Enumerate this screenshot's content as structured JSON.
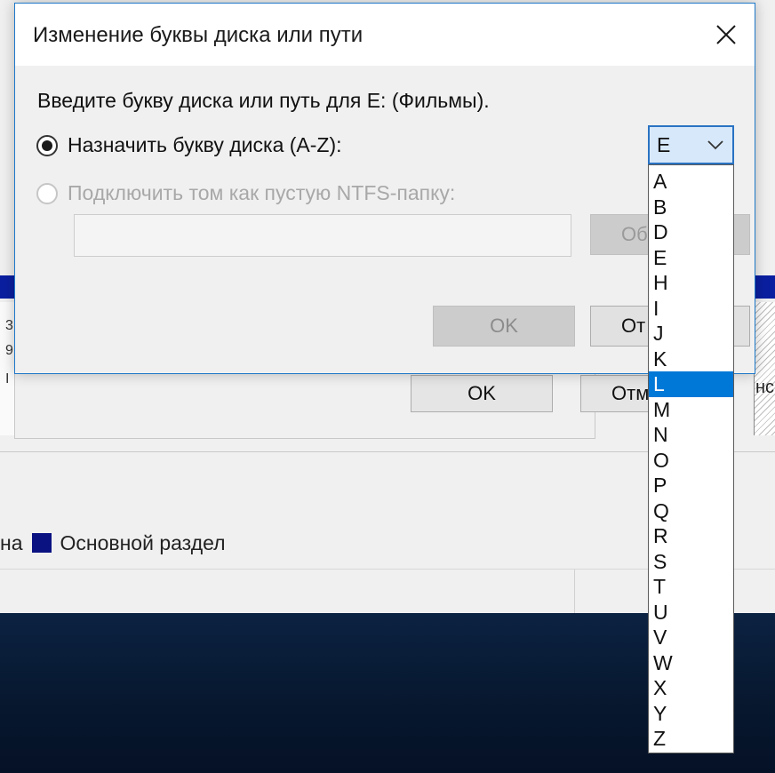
{
  "dialog": {
    "title": "Изменение буквы диска или пути",
    "prompt": "Введите букву диска или путь для E: (Фильмы).",
    "radio_assign_label": "Назначить букву диска (A-Z):",
    "radio_mount_label": "Подключить том как пустую NTFS-папку:",
    "path_value": "",
    "browse_label": "Об",
    "ok_label": "OK",
    "cancel_label": "От"
  },
  "dropdown": {
    "selected": "E",
    "highlighted": "L",
    "options": [
      "A",
      "B",
      "D",
      "E",
      "H",
      "I",
      "J",
      "K",
      "L",
      "M",
      "N",
      "O",
      "P",
      "Q",
      "R",
      "S",
      "T",
      "U",
      "V",
      "W",
      "X",
      "Y",
      "Z"
    ]
  },
  "background": {
    "ok_label": "OK",
    "cancel_label": "Отм",
    "hatch_text": "нс",
    "left_fragments": [
      "3",
      "9",
      "I"
    ],
    "legend_fragment": "на",
    "legend_label": "Основной раздел",
    "legend_color": "#0a1282"
  },
  "colors": {
    "accent": "#0078d7",
    "dialog_border": "#1f78c8",
    "desktop": "#0c2242"
  }
}
